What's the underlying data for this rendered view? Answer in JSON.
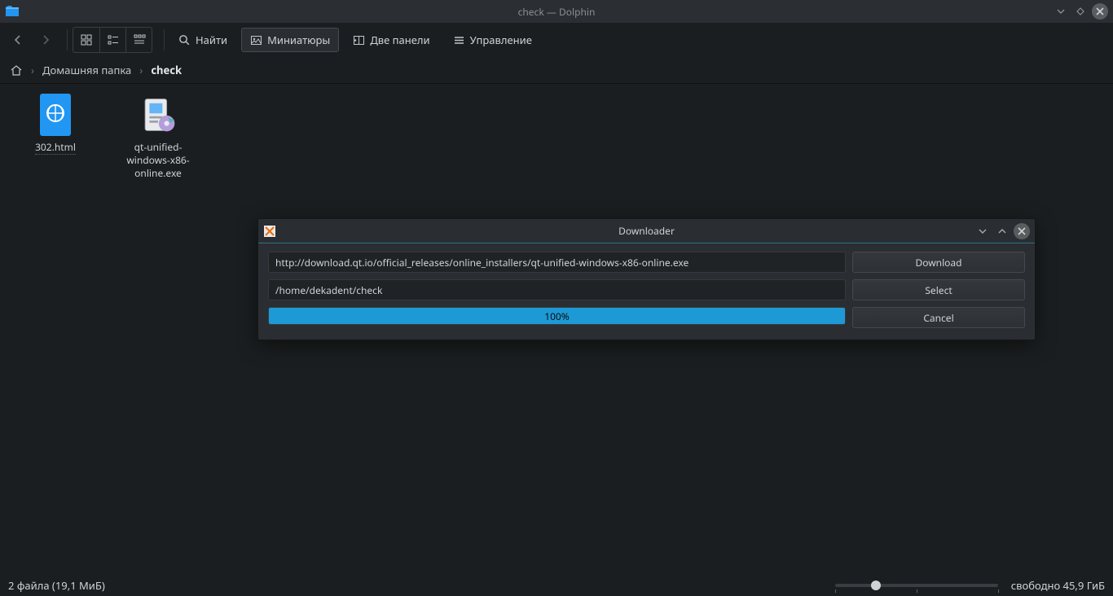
{
  "window": {
    "title": "check — Dolphin"
  },
  "toolbar": {
    "find": "Найти",
    "thumbnails": "Миниатюры",
    "split": "Две панели",
    "control": "Управление"
  },
  "breadcrumb": {
    "home": "Домашняя папка",
    "current": "check"
  },
  "files": [
    {
      "name": "302.html"
    },
    {
      "name": "qt-unified-windows-x86-online.exe"
    }
  ],
  "status": {
    "left": "2 файла (19,1 МиБ)",
    "right": "свободно 45,9 ГиБ"
  },
  "dialog": {
    "title": "Downloader",
    "url": "http://download.qt.io/official_releases/online_installers/qt-unified-windows-x86-online.exe",
    "path": "/home/dekadent/check",
    "progress_pct": 100,
    "progress_label": "100%",
    "btn_download": "Download",
    "btn_select": "Select",
    "btn_cancel": "Cancel"
  }
}
